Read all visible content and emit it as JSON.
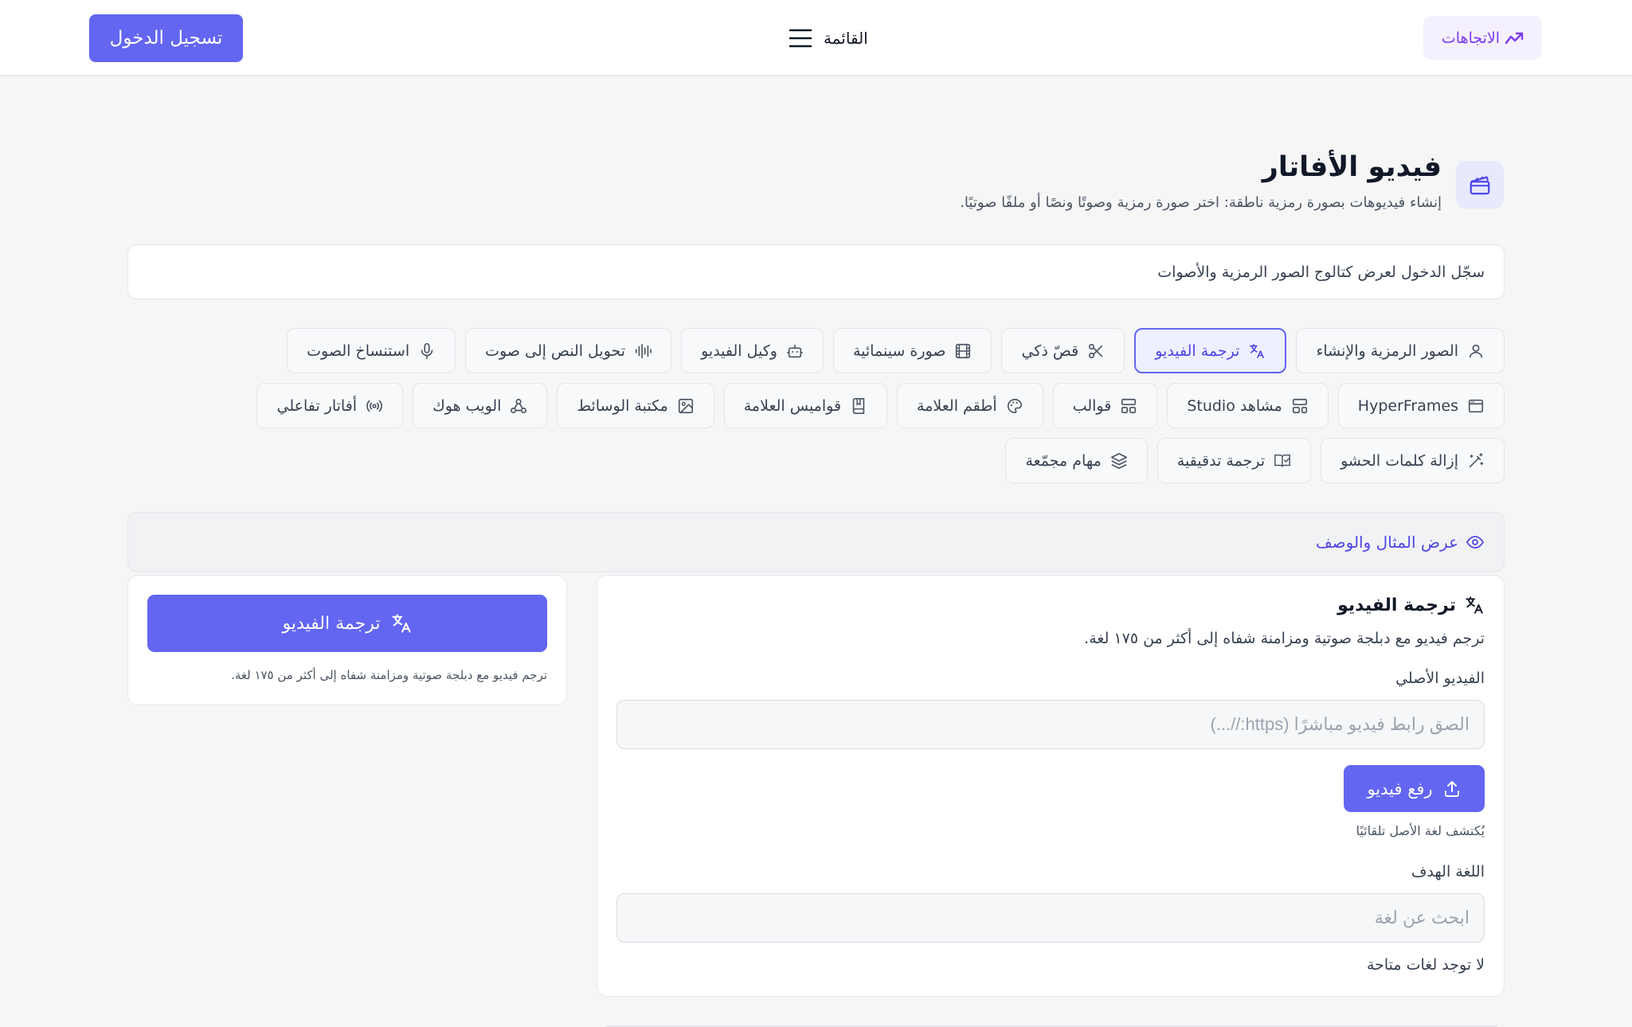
{
  "topbar": {
    "login_label": "تسجيل الدخول",
    "menu_label": "القائمة",
    "trends_label": "الاتجاهات"
  },
  "header": {
    "title": "فيديو الأفاتار",
    "subtitle": "إنشاء فيديوهات بصورة رمزية ناطقة: اختر صورة رمزية وصوتًا ونصًا أو ملفًا صوتيًا."
  },
  "notice": {
    "text": "سجّل الدخول لعرض كتالوج الصور الرمزية والأصوات"
  },
  "tools": {
    "row1": [
      {
        "label": "الصور الرمزية والإنشاء",
        "icon": "user-icon"
      },
      {
        "label": "ترجمة الفيديو",
        "icon": "translate-icon",
        "active": true
      },
      {
        "label": "قصّ ذكي",
        "icon": "scissors-icon"
      },
      {
        "label": "صورة سينمائية",
        "icon": "film-icon"
      },
      {
        "label": "وكيل الفيديو",
        "icon": "robot-icon"
      },
      {
        "label": "تحويل النص إلى صوت",
        "icon": "audio-wave-icon"
      },
      {
        "label": "استنساخ الصوت",
        "icon": "microphone-icon"
      }
    ],
    "row2": [
      {
        "label": "HyperFrames",
        "icon": "browser-window-icon"
      },
      {
        "label": "مشاهد Studio",
        "icon": "layout-icon"
      },
      {
        "label": "قوالب",
        "icon": "template-icon"
      },
      {
        "label": "أطقم العلامة",
        "icon": "palette-icon"
      },
      {
        "label": "قواميس العلامة",
        "icon": "book-icon"
      },
      {
        "label": "مكتبة الوسائط",
        "icon": "image-icon"
      },
      {
        "label": "الويب هوك",
        "icon": "webhook-icon"
      },
      {
        "label": "أفاتار تفاعلي",
        "icon": "broadcast-icon"
      }
    ],
    "row3": [
      {
        "label": "إزالة كلمات الحشو",
        "icon": "magic-wand-icon"
      },
      {
        "label": "ترجمة تدقيقية",
        "icon": "book-check-icon"
      },
      {
        "label": "مهام مجمّعة",
        "icon": "layers-icon"
      }
    ]
  },
  "example": {
    "label": "عرض المثال والوصف"
  },
  "form": {
    "title": "ترجمة الفيديو",
    "description": "ترجم فيديو مع دبلجة صوتية ومزامنة شفاه إلى أكثر من ١٧٥ لغة.",
    "source_label": "الفيديو الأصلي",
    "source_placeholder": "الصق رابط فيديو مباشرًا (https://...)",
    "upload_label": "رفع فيديو",
    "detect_hint": "يُكتشف لغة الأصل تلقائيًا",
    "target_label": "اللغة الهدف",
    "target_placeholder": "ابحث عن لغة",
    "no_languages": "لا توجد لغات متاحة"
  },
  "side": {
    "button_label": "ترجمة الفيديو",
    "note": "ترجم فيديو مع دبلجة صوتية ومزامنة شفاه إلى أكثر من ١٧٥ لغة."
  },
  "colors": {
    "accent": "#6366f1",
    "accent_dark": "#4f46e5",
    "trends": "#7c3aed",
    "background": "#f6f6f7"
  }
}
